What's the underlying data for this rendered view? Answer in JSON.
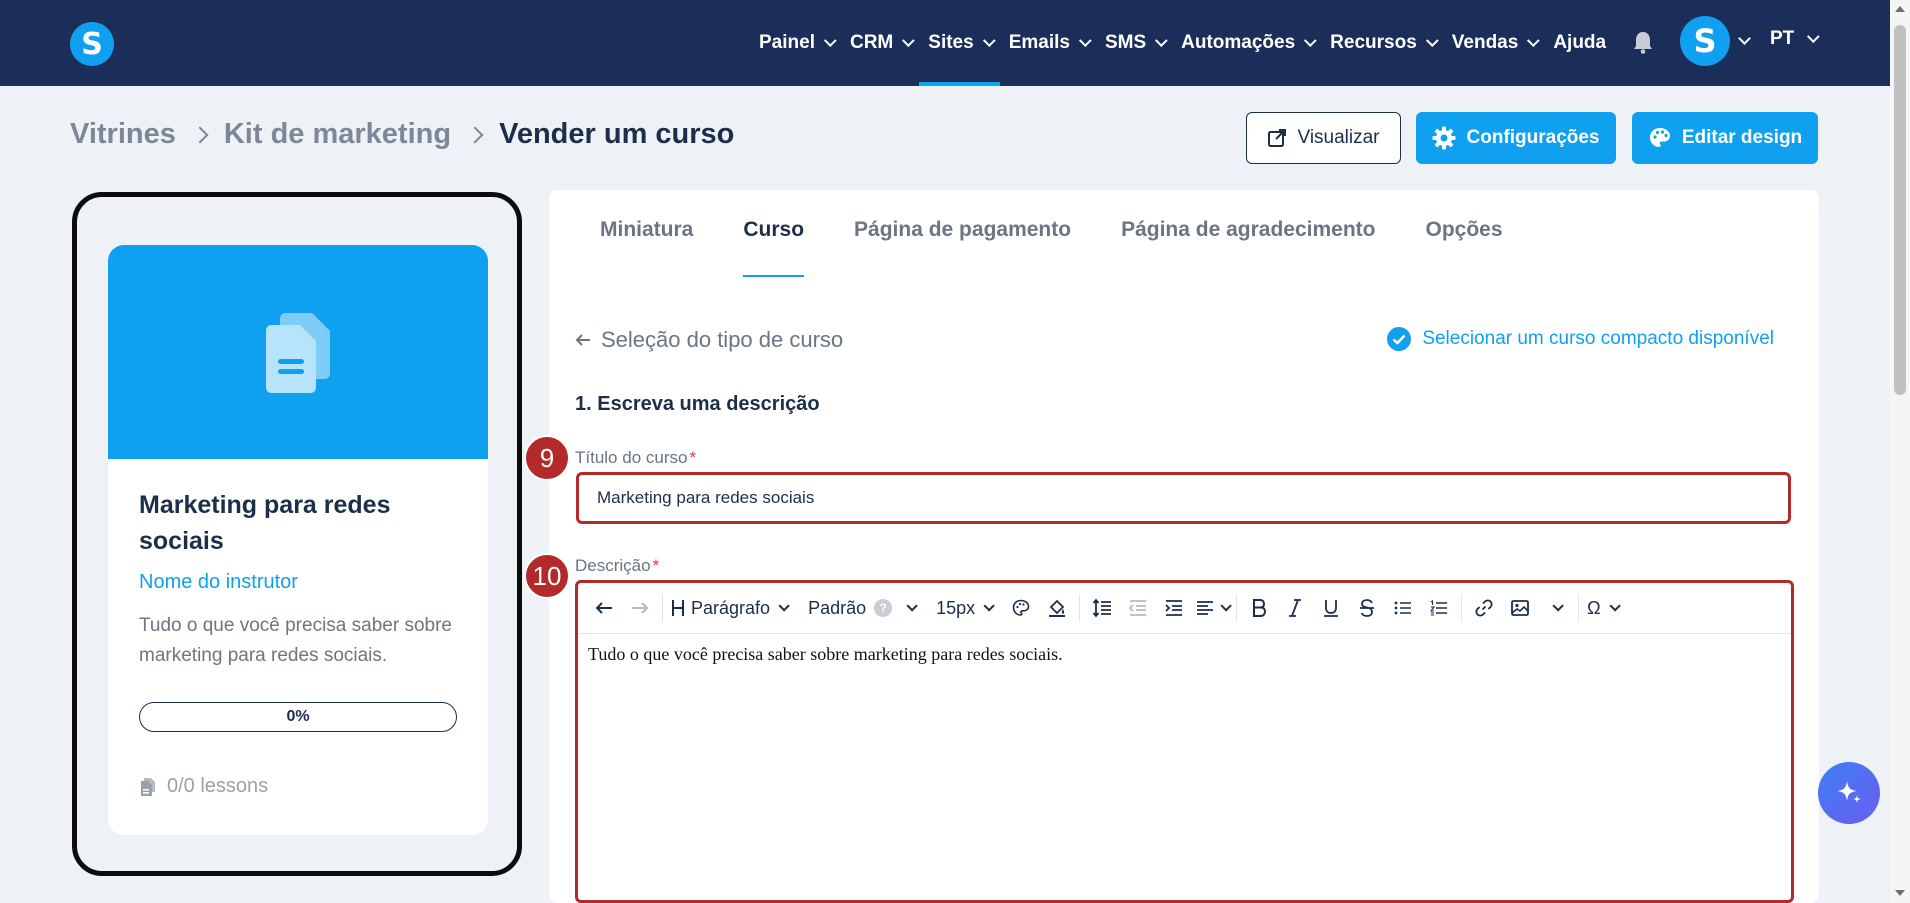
{
  "app": {
    "logo_letter": "S"
  },
  "nav": {
    "items": [
      {
        "label": "Painel",
        "has_chevron": true
      },
      {
        "label": "CRM",
        "has_chevron": true
      },
      {
        "label": "Sites",
        "has_chevron": true,
        "active": true
      },
      {
        "label": "Emails",
        "has_chevron": true
      },
      {
        "label": "SMS",
        "has_chevron": true
      },
      {
        "label": "Automações",
        "has_chevron": true
      },
      {
        "label": "Recursos",
        "has_chevron": true
      },
      {
        "label": "Vendas",
        "has_chevron": true
      },
      {
        "label": "Ajuda",
        "has_chevron": false
      }
    ],
    "avatar_letter": "S",
    "language": "PT"
  },
  "breadcrumb": {
    "items": [
      "Vitrines",
      "Kit de marketing"
    ],
    "current": "Vender um curso"
  },
  "actions": {
    "preview": "Visualizar",
    "settings": "Configurações",
    "edit_design": "Editar design"
  },
  "preview_card": {
    "title": "Marketing para redes sociais",
    "instructor": "Nome do instrutor",
    "description": "Tudo o que você precisa saber sobre marketing para redes sociais.",
    "progress": "0%",
    "lessons": "0/0 lessons"
  },
  "tabs": [
    "Miniatura",
    "Curso",
    "Página de pagamento",
    "Página de agradecimento",
    "Opções"
  ],
  "active_tab": "Curso",
  "form": {
    "back_link": "Seleção do tipo de curso",
    "compact_link": "Selecionar um curso compacto disponível",
    "section_title": "1. Escreva uma descrição",
    "title_label": "Título do curso",
    "title_value": "Marketing para redes sociais",
    "description_label": "Descrição",
    "description_value": "Tudo o que você precisa saber sobre marketing para redes sociais.",
    "required_mark": "*"
  },
  "toolbar": {
    "heading_label": "Parágrafo",
    "font_label": "Padrão",
    "help_mark": "?",
    "size_label": "15px",
    "special_char": "Ω"
  },
  "badges": {
    "title": "9",
    "description": "10"
  },
  "colors": {
    "nav_bg": "#1b2e5a",
    "accent": "#10a0f0",
    "highlight": "#b42a2a"
  }
}
